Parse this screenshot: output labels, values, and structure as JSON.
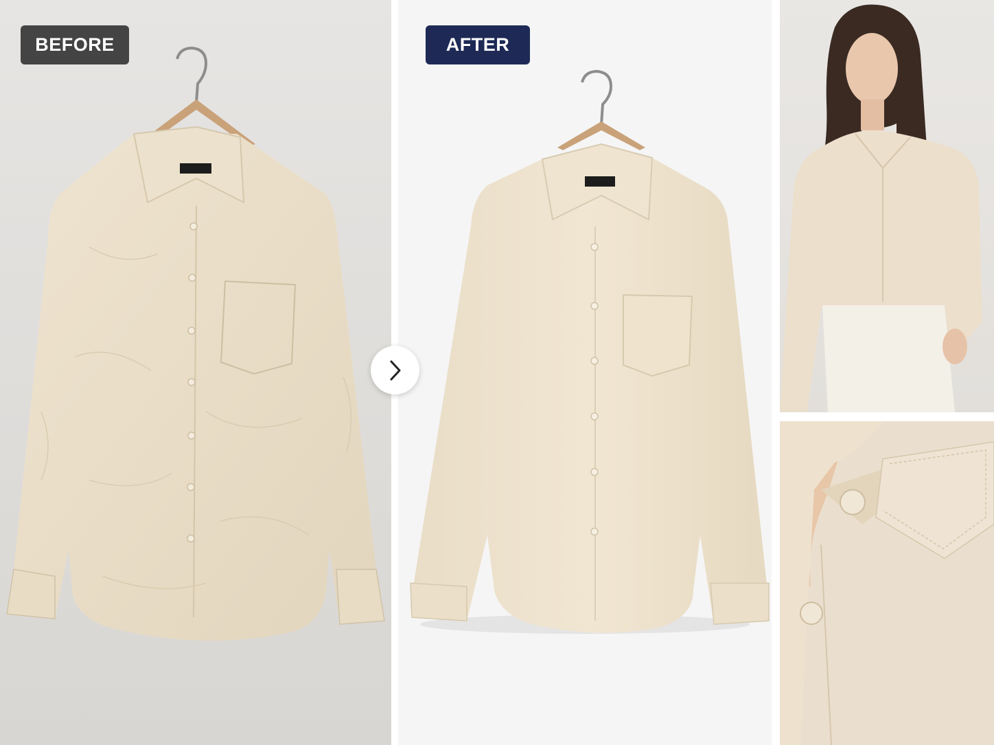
{
  "before_label": "BEFORE",
  "after_label": "AFTER",
  "next_icon": "chevron-right-icon",
  "colors": {
    "before_badge": "#444444",
    "after_badge": "#1e2a55",
    "shirt": "#ece1cd",
    "background_before": "#e2e0dd",
    "background_after": "#f5f5f5"
  }
}
